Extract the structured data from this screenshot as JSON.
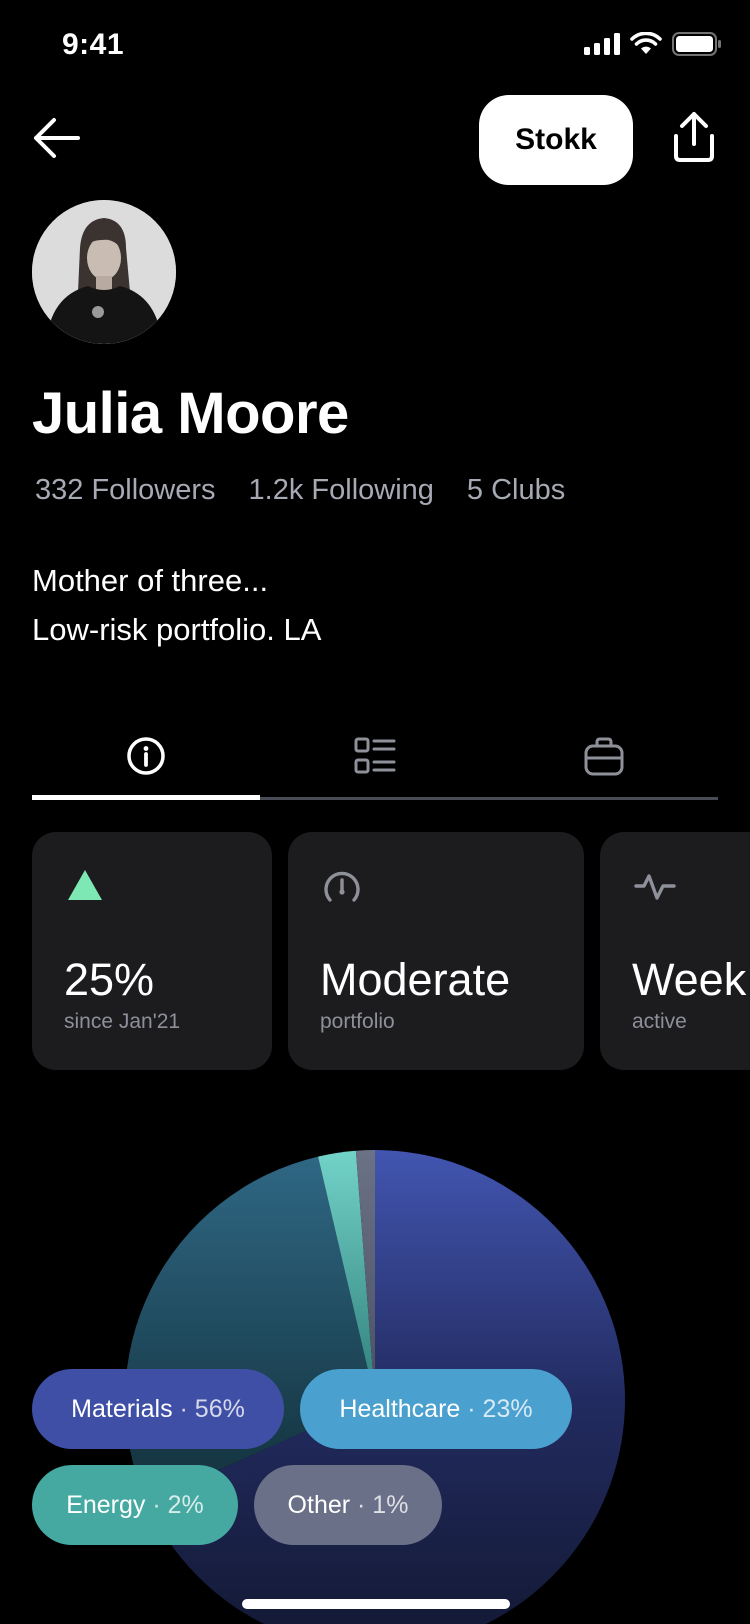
{
  "status": {
    "time": "9:41"
  },
  "header": {
    "stokk_label": "Stokk"
  },
  "profile": {
    "name": "Julia Moore",
    "followers": "332 Followers",
    "following": "1.2k Following",
    "clubs": "5 Clubs",
    "bio_line1": "Mother of three...",
    "bio_line2": "Low-risk portfolio. LA"
  },
  "tabs": [
    {
      "icon": "info-icon",
      "active": true
    },
    {
      "icon": "list-icon",
      "active": false
    },
    {
      "icon": "briefcase-icon",
      "active": false
    }
  ],
  "cards": [
    {
      "icon": "triangle-up-icon",
      "value": "25%",
      "sub": "since Jan'21",
      "accent": "#7ee8b4"
    },
    {
      "icon": "gauge-icon",
      "value": "Moderate",
      "sub": "portfolio"
    },
    {
      "icon": "activity-icon",
      "value": "Week",
      "sub": "active"
    }
  ],
  "legend": {
    "materials": {
      "label": "Materials",
      "pct": "· 56%",
      "color": "#3f4fa6"
    },
    "healthcare": {
      "label": "Healthcare",
      "pct": "· 23%",
      "color": "#4aa0cf"
    },
    "energy": {
      "label": "Energy",
      "pct": "· 2%",
      "color": "#45a9a2"
    },
    "other": {
      "label": "Other",
      "pct": "· 1%",
      "color": "#6a7088"
    }
  },
  "chart_data": {
    "type": "pie",
    "categories": [
      "Materials",
      "Healthcare",
      "Energy",
      "Other"
    ],
    "values": [
      56,
      23,
      2,
      1
    ],
    "colors": [
      "#2c3a8c",
      "#2c5573",
      "#4fb7ad",
      "#5e6577"
    ]
  }
}
